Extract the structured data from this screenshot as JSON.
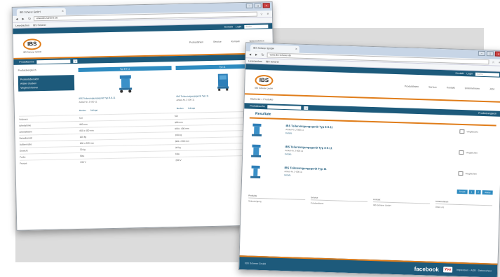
{
  "browser": {
    "tab_title": "IBS Scherer GmbH",
    "tab_close": "×",
    "url": "www.ibs-scherer.de",
    "nav_back": "◄",
    "nav_forward": "►",
    "nav_reload": "↻",
    "bookmark_1": "Lesezeichen",
    "bookmark_2": "IBS Scherer",
    "window_minimize": "–",
    "window_maximize": "□",
    "window_close": "×"
  },
  "site": {
    "topbar_links": [
      "Kontakt",
      "Login"
    ],
    "search_placeholder": "Suche",
    "logo_text": "IBS",
    "logo_sub": "IBS Scherer GmbH",
    "menu": [
      "Produktlinien",
      "Service",
      "Kontakt",
      "Unternehmen",
      "Jobs"
    ],
    "accent_color": "#e07d1a",
    "primary_color": "#1d5a7b"
  },
  "compare": {
    "searchbar_label": "Produktsuche",
    "searchbar_right": "Produktvergleich",
    "nav_title": "Produktvergleich",
    "nav_items": [
      "Produktübersicht",
      "Artikel drucken",
      "Vergleich leeren"
    ],
    "columns": [
      {
        "head": "Typ 8-9-11",
        "title": "IBS Teilereinigungsgerät Typ 8-9-11",
        "meta": "Artikel-Nr. 2-000-11",
        "action_1": "Merken",
        "action_2": "Anfrage"
      },
      {
        "head": "Typ 11",
        "title": "IBS Teilereinigungsgerät Typ 11",
        "meta": "Artikel-Nr. 2-000-11",
        "action_1": "Merken",
        "action_2": "Anfrage"
      }
    ],
    "spec_rows": [
      {
        "key": "Volumen",
        "v1": "50 l",
        "v2": "50 l"
      },
      {
        "key": "Arbeitshöhe",
        "v1": "900 mm",
        "v2": "900 mm"
      },
      {
        "key": "Arbeitsfläche",
        "v1": "600 x 400 mm",
        "v2": "600 x 400 mm"
      },
      {
        "key": "Belastbarkeit",
        "v1": "100 kg",
        "v2": "100 kg"
      },
      {
        "key": "Außenmaße",
        "v1": "800 x 600 mm",
        "v2": "800 x 600 mm"
      },
      {
        "key": "Gewicht",
        "v1": "30 kg",
        "v2": "30 kg"
      },
      {
        "key": "Farbe",
        "v1": "blau",
        "v2": "blau"
      },
      {
        "key": "Pumpe",
        "v1": "230 V",
        "v2": "230 V"
      }
    ]
  },
  "listing": {
    "breadcrumb": "Startseite > Produkte",
    "filter_label": "Produktsuche",
    "filter_right": "Produktvergleich",
    "results_title": "Resultate",
    "products": [
      {
        "name": "IBS Teilereinigungsgerät Typ 8-9-11",
        "sub": "Artikel-Nr. 2-000-11",
        "link": "Details",
        "compare": "Vergleichen"
      },
      {
        "name": "IBS Teilereinigungsgerät Typ 8-9-11",
        "sub": "Artikel-Nr. 2-000-11",
        "link": "Details",
        "compare": "Vergleichen"
      },
      {
        "name": "IBS Teilereinigungsgerät Typ 11",
        "sub": "Artikel-Nr. 2-000-11",
        "link": "Details",
        "compare": "Vergleichen"
      }
    ],
    "pager": [
      "Zurück",
      "1",
      "2",
      "Weiter"
    ],
    "foot_cols": [
      {
        "title": "Produkte",
        "text": "Teilereinigung"
      },
      {
        "title": "Service",
        "text": "Kundendienst"
      },
      {
        "title": "Kontakt",
        "text": "IBS Scherer GmbH"
      },
      {
        "title": "Unternehmen",
        "text": "Über uns"
      }
    ],
    "footer_left": "IBS Scherer GmbH",
    "facebook": "facebook",
    "youtube": "You",
    "footer_links": "Impressum · AGB · Datenschutz"
  }
}
